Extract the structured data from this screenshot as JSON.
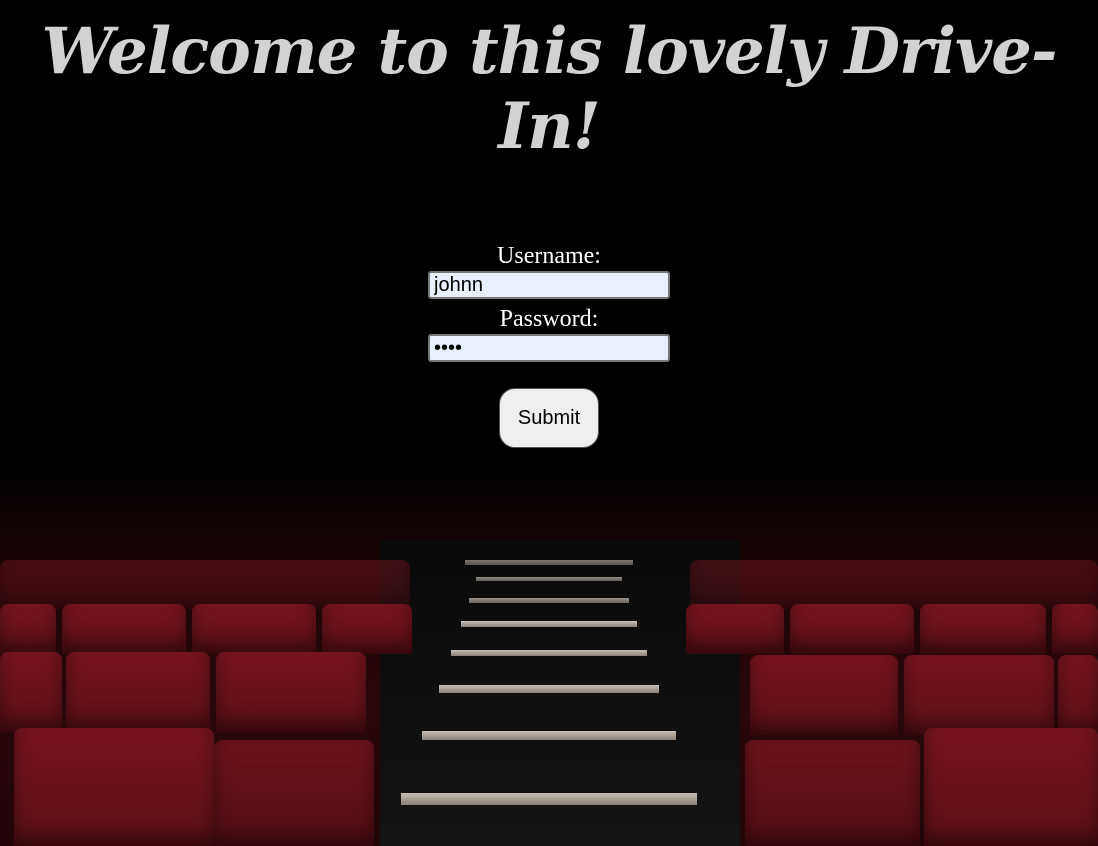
{
  "header": {
    "title": "Welcome to this lovely Drive-In!"
  },
  "form": {
    "username_label": "Username:",
    "username_value": "johnn",
    "password_label": "Password:",
    "password_value": "abcd",
    "submit_label": "Submit"
  }
}
